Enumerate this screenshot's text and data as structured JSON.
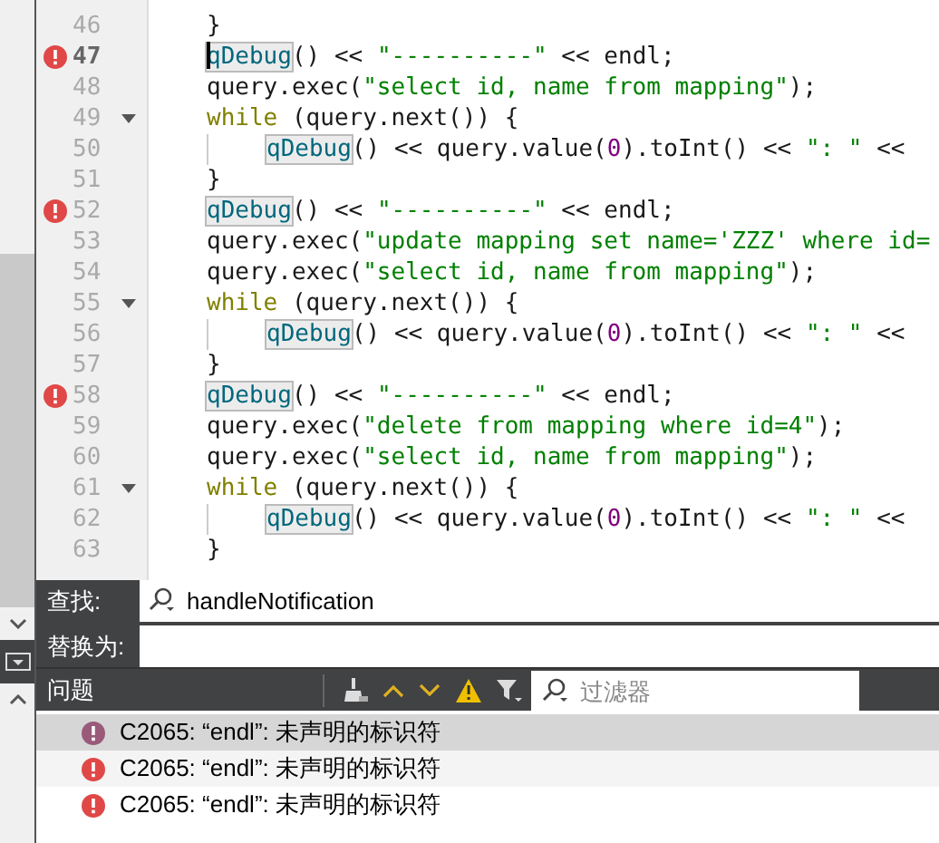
{
  "editor": {
    "lines": [
      {
        "number": "46",
        "error": false,
        "foldable": false,
        "current": false,
        "indented": false,
        "segments": [
          {
            "kind": "plain",
            "text": "}"
          }
        ]
      },
      {
        "number": "47",
        "error": true,
        "foldable": false,
        "current": true,
        "indented": false,
        "segments": [
          {
            "kind": "macro",
            "text": "qDebug"
          },
          {
            "kind": "plain",
            "text": "() << "
          },
          {
            "kind": "string",
            "text": "\"----------\""
          },
          {
            "kind": "plain",
            "text": " << endl;"
          }
        ]
      },
      {
        "number": "48",
        "error": false,
        "foldable": false,
        "current": false,
        "indented": false,
        "segments": [
          {
            "kind": "plain",
            "text": "query.exec("
          },
          {
            "kind": "string",
            "text": "\"select id, name from mapping\""
          },
          {
            "kind": "plain",
            "text": ");"
          }
        ]
      },
      {
        "number": "49",
        "error": false,
        "foldable": true,
        "current": false,
        "indented": false,
        "segments": [
          {
            "kind": "keyword",
            "text": "while"
          },
          {
            "kind": "plain",
            "text": " (query.next()) {"
          }
        ]
      },
      {
        "number": "50",
        "error": false,
        "foldable": false,
        "current": false,
        "indented": true,
        "segments": [
          {
            "kind": "macro",
            "text": "qDebug"
          },
          {
            "kind": "plain",
            "text": "() << query.value("
          },
          {
            "kind": "number",
            "text": "0"
          },
          {
            "kind": "plain",
            "text": ").toInt() << "
          },
          {
            "kind": "string",
            "text": "\": \""
          },
          {
            "kind": "plain",
            "text": " <<"
          }
        ]
      },
      {
        "number": "51",
        "error": false,
        "foldable": false,
        "current": false,
        "indented": false,
        "segments": [
          {
            "kind": "plain",
            "text": "}"
          }
        ]
      },
      {
        "number": "52",
        "error": true,
        "foldable": false,
        "current": false,
        "indented": false,
        "segments": [
          {
            "kind": "macro",
            "text": "qDebug"
          },
          {
            "kind": "plain",
            "text": "() << "
          },
          {
            "kind": "string",
            "text": "\"----------\""
          },
          {
            "kind": "plain",
            "text": " << endl;"
          }
        ]
      },
      {
        "number": "53",
        "error": false,
        "foldable": false,
        "current": false,
        "indented": false,
        "segments": [
          {
            "kind": "plain",
            "text": "query.exec("
          },
          {
            "kind": "string",
            "text": "\"update mapping set name='ZZZ' where id="
          }
        ]
      },
      {
        "number": "54",
        "error": false,
        "foldable": false,
        "current": false,
        "indented": false,
        "segments": [
          {
            "kind": "plain",
            "text": "query.exec("
          },
          {
            "kind": "string",
            "text": "\"select id, name from mapping\""
          },
          {
            "kind": "plain",
            "text": ");"
          }
        ]
      },
      {
        "number": "55",
        "error": false,
        "foldable": true,
        "current": false,
        "indented": false,
        "segments": [
          {
            "kind": "keyword",
            "text": "while"
          },
          {
            "kind": "plain",
            "text": " (query.next()) {"
          }
        ]
      },
      {
        "number": "56",
        "error": false,
        "foldable": false,
        "current": false,
        "indented": true,
        "segments": [
          {
            "kind": "macro",
            "text": "qDebug"
          },
          {
            "kind": "plain",
            "text": "() << query.value("
          },
          {
            "kind": "number",
            "text": "0"
          },
          {
            "kind": "plain",
            "text": ").toInt() << "
          },
          {
            "kind": "string",
            "text": "\": \""
          },
          {
            "kind": "plain",
            "text": " <<"
          }
        ]
      },
      {
        "number": "57",
        "error": false,
        "foldable": false,
        "current": false,
        "indented": false,
        "segments": [
          {
            "kind": "plain",
            "text": "}"
          }
        ]
      },
      {
        "number": "58",
        "error": true,
        "foldable": false,
        "current": false,
        "indented": false,
        "segments": [
          {
            "kind": "macro",
            "text": "qDebug"
          },
          {
            "kind": "plain",
            "text": "() << "
          },
          {
            "kind": "string",
            "text": "\"----------\""
          },
          {
            "kind": "plain",
            "text": " << endl;"
          }
        ]
      },
      {
        "number": "59",
        "error": false,
        "foldable": false,
        "current": false,
        "indented": false,
        "segments": [
          {
            "kind": "plain",
            "text": "query.exec("
          },
          {
            "kind": "string",
            "text": "\"delete from mapping where id=4\""
          },
          {
            "kind": "plain",
            "text": ");"
          }
        ]
      },
      {
        "number": "60",
        "error": false,
        "foldable": false,
        "current": false,
        "indented": false,
        "segments": [
          {
            "kind": "plain",
            "text": "query.exec("
          },
          {
            "kind": "string",
            "text": "\"select id, name from mapping\""
          },
          {
            "kind": "plain",
            "text": ");"
          }
        ]
      },
      {
        "number": "61",
        "error": false,
        "foldable": true,
        "current": false,
        "indented": false,
        "segments": [
          {
            "kind": "keyword",
            "text": "while"
          },
          {
            "kind": "plain",
            "text": " (query.next()) {"
          }
        ]
      },
      {
        "number": "62",
        "error": false,
        "foldable": false,
        "current": false,
        "indented": true,
        "segments": [
          {
            "kind": "macro",
            "text": "qDebug"
          },
          {
            "kind": "plain",
            "text": "() << query.value("
          },
          {
            "kind": "number",
            "text": "0"
          },
          {
            "kind": "plain",
            "text": ").toInt() << "
          },
          {
            "kind": "string",
            "text": "\": \""
          },
          {
            "kind": "plain",
            "text": " <<"
          }
        ]
      },
      {
        "number": "63",
        "error": false,
        "foldable": false,
        "current": false,
        "indented": false,
        "segments": [
          {
            "kind": "plain",
            "text": "}"
          }
        ]
      }
    ]
  },
  "find": {
    "find_label": "查找:",
    "find_value": "handleNotification",
    "replace_label": "替换为:"
  },
  "problems": {
    "title": "问题",
    "filter_placeholder": "过滤器",
    "items": [
      {
        "text": "C2065: “endl”: 未声明的标识符",
        "selected": true
      },
      {
        "text": "C2065: “endl”: 未声明的标识符",
        "selected": false
      },
      {
        "text": "C2065: “endl”: 未声明的标识符",
        "selected": false
      }
    ]
  }
}
